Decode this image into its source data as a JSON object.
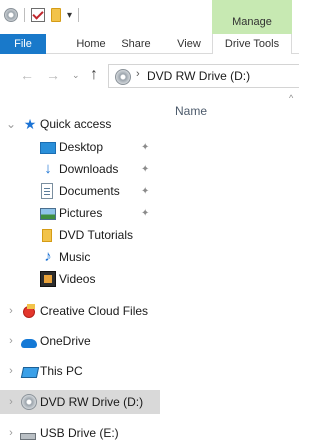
{
  "titlebar": {
    "qat_dropdown": "▾",
    "contextual_group": "Manage"
  },
  "ribbon": {
    "tabs": [
      {
        "label": "File"
      },
      {
        "label": "Home"
      },
      {
        "label": "Share"
      },
      {
        "label": "View"
      },
      {
        "label": "Drive Tools"
      }
    ]
  },
  "address": {
    "back": "←",
    "forward": "→",
    "recent": "⌄",
    "up": "↑",
    "chevron": "›",
    "path": "DVD RW Drive (D:)"
  },
  "content": {
    "column_name": "Name",
    "sort_caret": "^"
  },
  "navpane": {
    "quick_access": "Quick access",
    "items": [
      {
        "label": "Desktop",
        "icon": "desktop-icon",
        "pinned": true
      },
      {
        "label": "Downloads",
        "icon": "downloads-icon",
        "pinned": true
      },
      {
        "label": "Documents",
        "icon": "documents-icon",
        "pinned": true
      },
      {
        "label": "Pictures",
        "icon": "pictures-icon",
        "pinned": true
      },
      {
        "label": "DVD Tutorials",
        "icon": "folder-icon",
        "pinned": false
      },
      {
        "label": "Music",
        "icon": "music-icon",
        "pinned": false
      },
      {
        "label": "Videos",
        "icon": "videos-icon",
        "pinned": false
      }
    ],
    "roots": [
      {
        "label": "Creative Cloud Files",
        "icon": "creative-cloud-icon"
      },
      {
        "label": "OneDrive",
        "icon": "onedrive-icon"
      },
      {
        "label": "This PC",
        "icon": "this-pc-icon"
      },
      {
        "label": "DVD RW Drive (D:)",
        "icon": "dvd-drive-icon",
        "selected": true
      },
      {
        "label": "USB Drive (E:)",
        "icon": "usb-drive-icon"
      }
    ],
    "expander": "›",
    "expander_open": "⌄",
    "pin_glyph": "✦"
  },
  "colors": {
    "file_tab": "#1979ca",
    "manage_tab": "#c7e9b2",
    "selected_row": "#d9d9d9",
    "accent_blue": "#1c73d4"
  }
}
